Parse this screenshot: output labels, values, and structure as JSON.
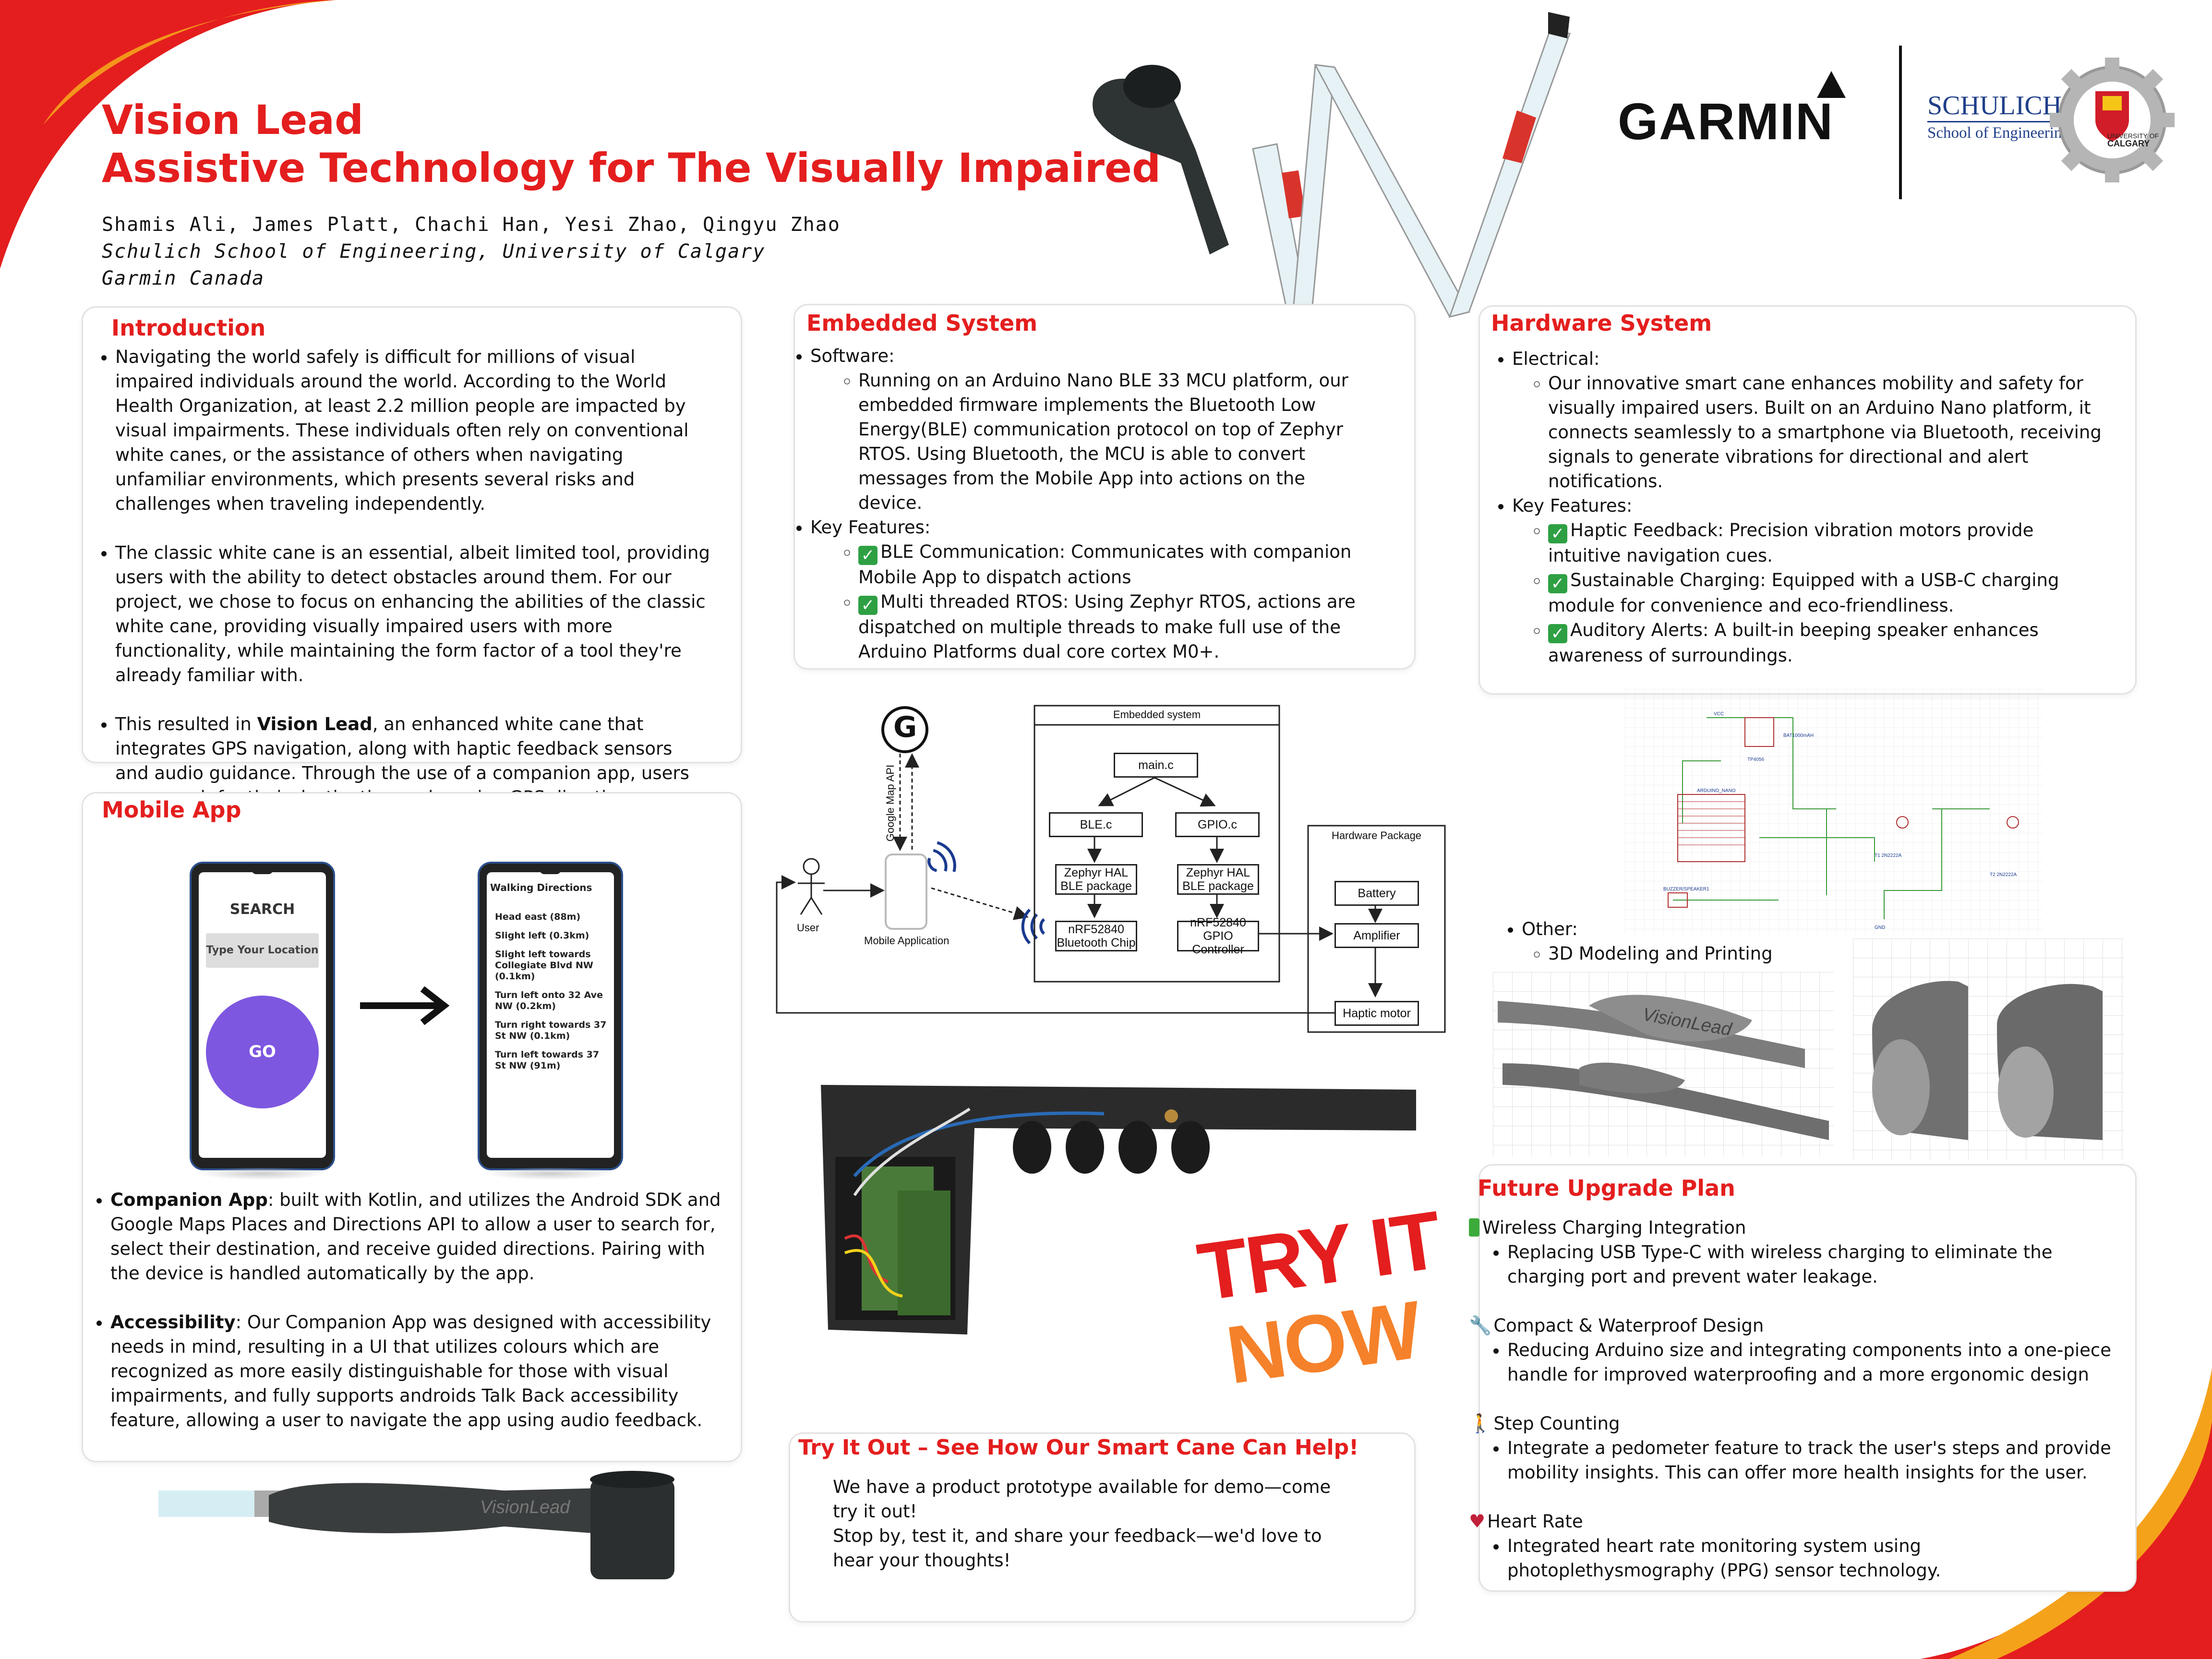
{
  "header": {
    "title_line1": "Vision Lead",
    "title_line2": "Assistive Technology for The Visually Impaired",
    "authors": "Shamis Ali, James Platt, Chachi Han, Yesi Zhao, Qingyu Zhao",
    "affiliation1": "Schulich School of Engineering, University of Calgary",
    "affiliation2": "Garmin Canada",
    "garmin_logo": "GARMIN",
    "schulich_line1": "SCHULICH",
    "schulich_line2": "School of Engineering",
    "uofc_line1": "UNIVERSITY OF",
    "uofc_line2": "CALGARY"
  },
  "introduction": {
    "title": "Introduction",
    "p1": "Navigating the world safely is difficult for millions of visual impaired individuals around the world. According to the World Health Organization, at least 2.2 million people are impacted by visual impairments. These individuals often rely on conventional white canes, or the assistance of others when navigating unfamiliar environments, which presents several risks and challenges when traveling independently.",
    "p2": "The classic white cane is an essential, albeit limited tool, providing users with the ability to detect obstacles around them. For our project, we chose to focus on enhancing the abilities of the classic white cane, providing visually impaired users with more functionality, while maintaining the form factor of a tool they're already familiar with.",
    "p3_pre": "This resulted in ",
    "p3_bold": "Vision Lead",
    "p3_post": ", an enhanced white cane that integrates GPS navigation, along with haptic feedback sensors and audio guidance. Through the use of a companion app, users can search for their destination and receive GPS directions, directly through their device."
  },
  "mobile_app": {
    "title": "Mobile App",
    "phone1_title": "SEARCH",
    "phone1_placeholder": "Type Your Location",
    "phone1_button": "GO",
    "phone2_title": "Walking Directions",
    "phone2_steps": [
      "Head east (88m)",
      "Slight left (0.3km)",
      "Slight left towards Collegiate Blvd NW (0.1km)",
      "Turn left onto 32 Ave NW (0.2km)",
      "Turn right towards 37 St NW (0.1km)",
      "Turn left towards 37 St NW (91m)"
    ],
    "b1_bold": "Companion App",
    "b1_text": ": built with Kotlin, and utilizes the Android SDK and Google Maps Places and Directions API to allow a user to search for, select their destination, and receive guided directions. Pairing with the device is handled automatically by the app.",
    "b2_bold": "Accessibility",
    "b2_text": ": Our Companion App was designed with accessibility needs in mind, resulting in a UI that utilizes colours which are recognized as more easily distinguishable for those with visual impairments, and fully supports androids Talk Back accessibility feature, allowing a user to navigate the app using audio feedback.",
    "handle_text": "VisionLead"
  },
  "embedded": {
    "title": "Embedded System",
    "software_label": "Software:",
    "software_text": "Running on an Arduino Nano BLE 33 MCU platform, our embedded firmware implements the Bluetooth Low Energy(BLE) communication protocol on top of Zephyr RTOS. Using Bluetooth, the MCU is able to convert messages from the Mobile App into actions on the device.",
    "features_label": "Key Features:",
    "feature1": "BLE Communication: Communicates with companion Mobile App to dispatch actions",
    "feature2": "Multi threaded RTOS: Using Zephyr RTOS, actions are dispatched on multiple threads to make full use of the Arduino Platforms dual core cortex M0+."
  },
  "diagram": {
    "google_letter": "G",
    "api_label": "Google Map API",
    "user_label": "User",
    "mobile_label": "Mobile Application",
    "embedded_label": "Embedded system",
    "main": "main.c",
    "ble": "BLE.c",
    "gpio": "GPIO.c",
    "hal1": "Zephyr HAL BLE package",
    "hal2": "Zephyr HAL BLE package",
    "chip1": "nRF52840 Bluetooth Chip",
    "chip2": "nRF52840 GPIO Controller",
    "hw_label": "Hardware Package",
    "battery": "Battery",
    "amplifier": "Amplifier",
    "haptic": "Haptic motor"
  },
  "hardware": {
    "title": "Hardware System",
    "electrical_label": "Electrical:",
    "electrical_text": "Our innovative smart cane enhances mobility and safety for visually impaired users. Built on an Arduino Nano platform, it connects seamlessly to a smartphone via Bluetooth, receiving signals to generate vibrations for directional and alert notifications.",
    "features_label": "Key Features:",
    "feature1": "Haptic Feedback: Precision vibration motors provide intuitive navigation cues.",
    "feature2": "Sustainable Charging: Equipped with a USB-C charging module for convenience and eco-friendliness.",
    "feature3": "Auditory Alerts: A built-in beeping speaker enhances awareness of surroundings.",
    "other_label": "Other:",
    "other_item": "3D Modeling and Printing",
    "model_text": "VisionLead"
  },
  "try_it": {
    "stamp1": "TRY IT",
    "stamp2": "NOW",
    "title": "Try It Out – See How Our Smart Cane Can Help!",
    "line1": "We have a product prototype available for demo—come try it out!",
    "line2": "Stop by, test it, and share your feedback—we'd love to hear your thoughts!"
  },
  "future": {
    "title": "Future Upgrade Plan",
    "items": [
      {
        "icon": "battery-icon",
        "heading": "Wireless Charging Integration",
        "text": "Replacing USB Type-C with wireless charging to eliminate the charging port and prevent water leakage."
      },
      {
        "icon": "wrench-icon",
        "heading": "Compact & Waterproof Design",
        "text": "Reducing Arduino size and integrating components into a one-piece handle for improved waterproofing and a more ergonomic design"
      },
      {
        "icon": "walking-icon",
        "heading": "Step Counting",
        "text": "Integrate a pedometer feature to track the user's steps and provide mobility insights. This can offer more health insights for the user."
      },
      {
        "icon": "heart-icon",
        "heading": "Heart Rate",
        "text": "Integrated heart rate monitoring system using photoplethysmography (PPG) sensor technology."
      }
    ]
  },
  "colors": {
    "accent": "#e41e1e",
    "orange": "#f5a21b",
    "purple": "#7e57e0"
  }
}
